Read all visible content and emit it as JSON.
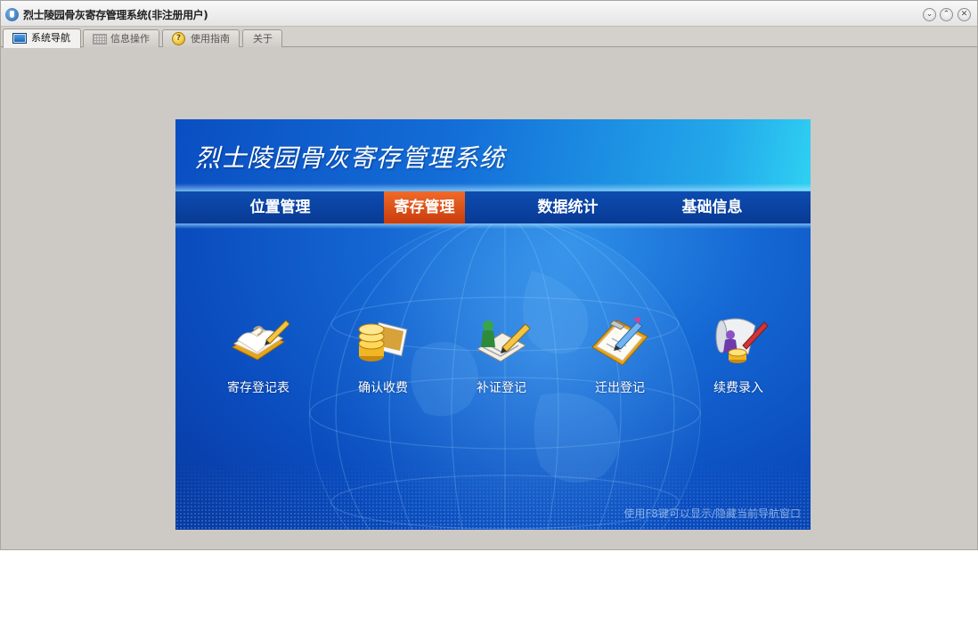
{
  "window": {
    "title": "烈士陵园骨灰寄存管理系统(非注册用户)",
    "controls": [
      "minimize",
      "maximize",
      "close"
    ]
  },
  "tabs": [
    {
      "label": "系统导航",
      "icon": "monitor-icon",
      "active": true
    },
    {
      "label": "信息操作",
      "icon": "grid-icon",
      "active": false
    },
    {
      "label": "使用指南",
      "icon": "help-icon",
      "active": false
    },
    {
      "label": "关于",
      "icon": "",
      "active": false
    }
  ],
  "panel": {
    "title": "烈士陵园骨灰寄存管理系统",
    "menu": [
      {
        "label": "位置管理",
        "active": false
      },
      {
        "label": "寄存管理",
        "active": true
      },
      {
        "label": "数据统计",
        "active": false
      },
      {
        "label": "基础信息",
        "active": false
      }
    ],
    "features": [
      {
        "label": "寄存登记表",
        "icon": "register-book-icon"
      },
      {
        "label": "确认收费",
        "icon": "coins-icon"
      },
      {
        "label": "补证登记",
        "icon": "certificate-icon"
      },
      {
        "label": "迁出登记",
        "icon": "clipboard-icon"
      },
      {
        "label": "续费录入",
        "icon": "scroll-money-icon"
      }
    ],
    "hint": "使用F8键可以显示/隐藏当前导航窗口"
  },
  "colors": {
    "window_bg": "#cdc9c5",
    "panel_blue": "#0a4bbd",
    "menu_active": "#e4561b",
    "header_cyan": "#2fd0f2"
  }
}
